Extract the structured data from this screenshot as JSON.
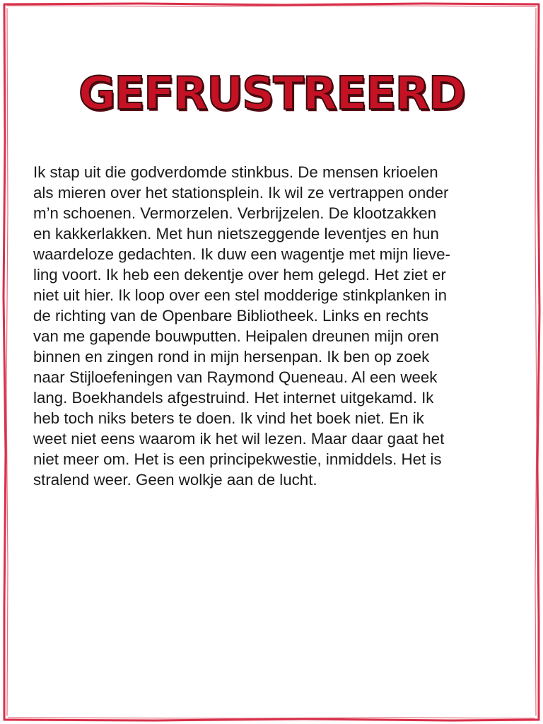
{
  "title": "GEFRUSTREERD",
  "colors": {
    "frame": "#d9304a",
    "title_fill": "#c41224",
    "title_outline": "#3a0a0e",
    "text": "#1a1a1a",
    "background": "#ffffff"
  },
  "body_lines": [
    "Ik stap uit die godverdomde stinkbus. De mensen krioelen",
    "als mieren over het stationsplein. Ik wil ze vertrappen onder",
    "m’n schoenen. Vermorzelen. Verbrijzelen. De klootzakken",
    "en kakkerlakken. Met hun nietszeggende leventjes en hun",
    "waardeloze gedachten. Ik duw een wagentje met mijn lieve-",
    "ling voort. Ik heb een dekentje over hem gelegd. Het ziet er",
    "niet uit hier. Ik loop over een stel modderige stinkplanken in",
    "de richting van de Openbare Bibliotheek. Links en rechts",
    "van me gapende bouwputten. Heipalen dreunen mijn oren",
    "binnen en zingen rond in mijn hersenpan. Ik ben op zoek",
    "naar Stijloefeningen van Raymond Queneau. Al een week",
    "lang. Boekhandels afgestruind. Het internet uitgekamd. Ik",
    "heb toch niks beters te doen. Ik vind het boek niet. En ik",
    "weet niet eens waarom ik het wil lezen. Maar daar gaat het",
    "niet meer om. Het is een principekwestie, inmiddels. Het is",
    "stralend weer. Geen wolkje aan de lucht."
  ]
}
